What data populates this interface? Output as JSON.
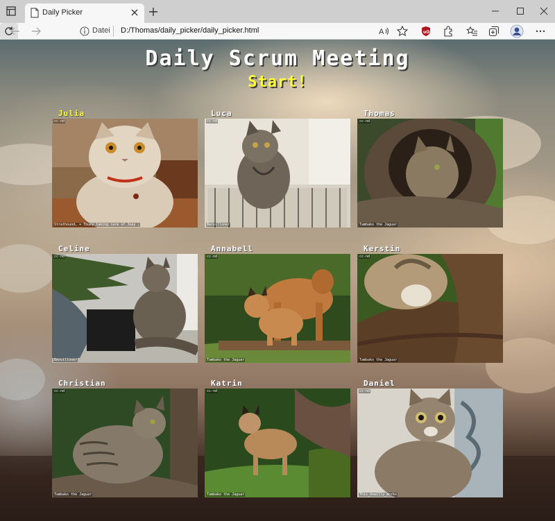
{
  "browser": {
    "tab_title": "Daily Picker",
    "url_scheme": "Datei",
    "url": "D:/Thomas/daily_picker/daily_picker.html"
  },
  "page": {
    "title": "Daily Scrum Meeting",
    "start_label": "Start!",
    "highlight_color": "#ffff33",
    "participants": [
      {
        "name": "Julia",
        "active": true,
        "license": "cc-nd",
        "credit": "Strathound, + Tbuey taking care of Joey ;",
        "photo": "fluffy-persian-cat"
      },
      {
        "name": "Luca",
        "active": false,
        "license": "cc-nd",
        "credit": "Benvilloner",
        "photo": "tabby-cat-in-basket"
      },
      {
        "name": "Thomas",
        "active": false,
        "license": "cc-nd",
        "credit": "Tambako the Jaguar",
        "photo": "wildcat-in-tree-hollow"
      },
      {
        "name": "Celine",
        "active": false,
        "license": "cc-nd",
        "credit": "Benvilloner",
        "photo": "cat-playing-with-christmas-tree"
      },
      {
        "name": "Annabell",
        "active": false,
        "license": "cc-nd",
        "credit": "Tambako the Jaguar",
        "photo": "lynx-mother-and-cub"
      },
      {
        "name": "Kerstin",
        "active": false,
        "license": "cc-nd",
        "credit": "Tambako the Jaguar",
        "photo": "wildcat-paw-on-log"
      },
      {
        "name": "Christian",
        "active": false,
        "license": "cc-nd",
        "credit": "Tambako the Jaguar",
        "photo": "wildcat-lying-on-log"
      },
      {
        "name": "Katrin",
        "active": false,
        "license": "cc-nd",
        "credit": "Tambako the Jaguar",
        "photo": "lynx-cub-walking"
      },
      {
        "name": "Daniel",
        "active": false,
        "license": "cc-nd",
        "credit": "This_Unwilly_Works",
        "photo": "tabby-kitten"
      }
    ]
  }
}
